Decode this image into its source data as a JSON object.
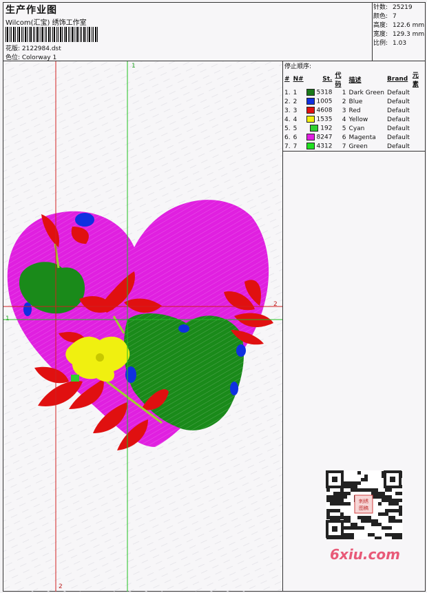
{
  "header": {
    "title": "生产作业图",
    "company": "Wilcom(汇宝) 绣饰工作室",
    "design_label": "花版: 2122984.dst",
    "colorway_label": "色位: Colorway 1"
  },
  "stats": [
    {
      "key": "针数:",
      "value": "25219"
    },
    {
      "key": "颜色:",
      "value": "7"
    },
    {
      "key": "高度:",
      "value": "122.6 mm"
    },
    {
      "key": "宽度:",
      "value": "129.3 mm"
    },
    {
      "key": "比例:",
      "value": "1.03"
    }
  ],
  "stop_sequence": {
    "title": "停止顺序:",
    "columns": [
      "#",
      "N#",
      "St.",
      "代码",
      "描述",
      "Brand",
      "元素"
    ],
    "rows": [
      {
        "idx": "1.",
        "n": "1",
        "color": "#1a7a1a",
        "st": "5318",
        "code": "1",
        "desc": "Dark Green",
        "brand": "Default"
      },
      {
        "idx": "2.",
        "n": "2",
        "color": "#1030e0",
        "st": "1005",
        "code": "2",
        "desc": "Blue",
        "brand": "Default"
      },
      {
        "idx": "3.",
        "n": "3",
        "color": "#e01010",
        "st": "4608",
        "code": "3",
        "desc": "Red",
        "brand": "Default"
      },
      {
        "idx": "4.",
        "n": "4",
        "color": "#f0f010",
        "st": "1535",
        "code": "4",
        "desc": "Yellow",
        "brand": "Default"
      },
      {
        "idx": "5.",
        "n": "5",
        "color": "#30d030",
        "st": "192",
        "code": "5",
        "desc": "Cyan",
        "brand": "Default"
      },
      {
        "idx": "6.",
        "n": "6",
        "color": "#e020e0",
        "st": "8247",
        "code": "6",
        "desc": "Magenta",
        "brand": "Default"
      },
      {
        "idx": "7.",
        "n": "7",
        "color": "#20e020",
        "st": "4312",
        "code": "7",
        "desc": "Green",
        "brand": "Default"
      }
    ]
  },
  "guides": {
    "mark1": "1",
    "mark2": "2"
  },
  "watermark": "6xiu.com",
  "qr_stamp": "刺绣图稿"
}
